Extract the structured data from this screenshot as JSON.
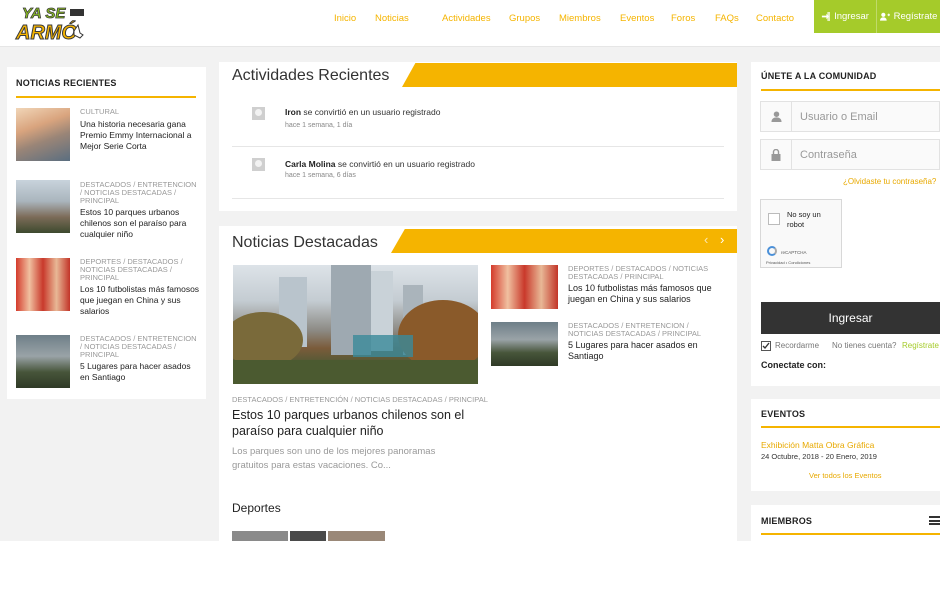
{
  "header": {
    "logo_line1": "YA SE",
    "logo_line2": "ARMÓ",
    "nav": [
      "Inicio",
      "Noticias",
      "Actividades",
      "Grupos",
      "Miembros",
      "Eventos",
      "Foros",
      "FAQs",
      "Contacto"
    ],
    "login_label": "Ingresar",
    "register_label": "Regístrate"
  },
  "sidebar_left": {
    "title": "NOTICIAS RECIENTES",
    "items": [
      {
        "category": "CULTURAL",
        "title": "Una historia necesaria gana Premio Emmy Internacional a Mejor Serie Corta"
      },
      {
        "category": "DESTACADOS / ENTRETENCION / NOTICIAS DESTACADAS / PRINCIPAL",
        "title": "Estos 10 parques urbanos chilenos son el paraíso para cualquier niño"
      },
      {
        "category": "DEPORTES / DESTACADOS / NOTICIAS DESTACADAS / PRINCIPAL",
        "title": "Los 10 futbolistas más famosos que juegan en China y sus salarios"
      },
      {
        "category": "DESTACADOS / ENTRETENCION / NOTICIAS DESTACADAS / PRINCIPAL",
        "title": "5 Lugares para hacer asados en Santiago"
      }
    ]
  },
  "activities": {
    "title": "Actividades Recientes",
    "items": [
      {
        "user": "Iron",
        "text": " se convirtió en un usuario registrado",
        "time": "hace 1 semana, 1 día"
      },
      {
        "user": "Carla Molina",
        "text": " se convirtió en un usuario registrado",
        "time": "hace 1 semana, 6 días"
      }
    ]
  },
  "featured": {
    "title": "Noticias Destacadas",
    "prev_arrow": "‹",
    "next_arrow": "›",
    "main": {
      "category": "DESTACADOS / ENTRETENCIÓN / NOTICIAS DESTACADAS / PRINCIPAL",
      "title": "Estos 10 parques urbanos chilenos son el paraíso para cualquier niño",
      "excerpt": "Los parques son uno de los mejores panoramas gratuitos para estas vacaciones. Co..."
    },
    "side": [
      {
        "category": "DEPORTES / DESTACADOS / NOTICIAS DESTACADAS / PRINCIPAL",
        "title": "Los 10 futbolistas más famosos que juegan en China y sus salarios"
      },
      {
        "category": "DESTACADOS / ENTRETENCION / NOTICIAS DESTACADAS / PRINCIPAL",
        "title": "5 Lugares para hacer asados en Santiago"
      }
    ],
    "sports_heading": "Deportes"
  },
  "community": {
    "title": "ÚNETE A LA COMUNIDAD",
    "username_placeholder": "Usuario o Email",
    "password_placeholder": "Contraseña",
    "forgot": "¿Olvidaste tu contraseña?",
    "captcha_label": "No soy un robot",
    "captcha_brand": "reCAPTCHA",
    "captcha_links": "Privacidad • Condiciones",
    "login_button": "Ingresar",
    "remember": "Recordarme",
    "no_account": "No tienes cuenta?",
    "register_link": "Regístrate",
    "connect": "Conectate con:"
  },
  "events": {
    "title": "EVENTOS",
    "event_name": "Exhibición Matta Obra Gráfica",
    "event_dates": "24 Octubre, 2018 - 20 Enero, 2019",
    "see_all": "Ver todos los Eventos"
  },
  "members": {
    "title": "MIEMBROS"
  },
  "colors": {
    "accent": "#f5b400",
    "green": "#a5cb2a",
    "dark_button": "#333333"
  }
}
